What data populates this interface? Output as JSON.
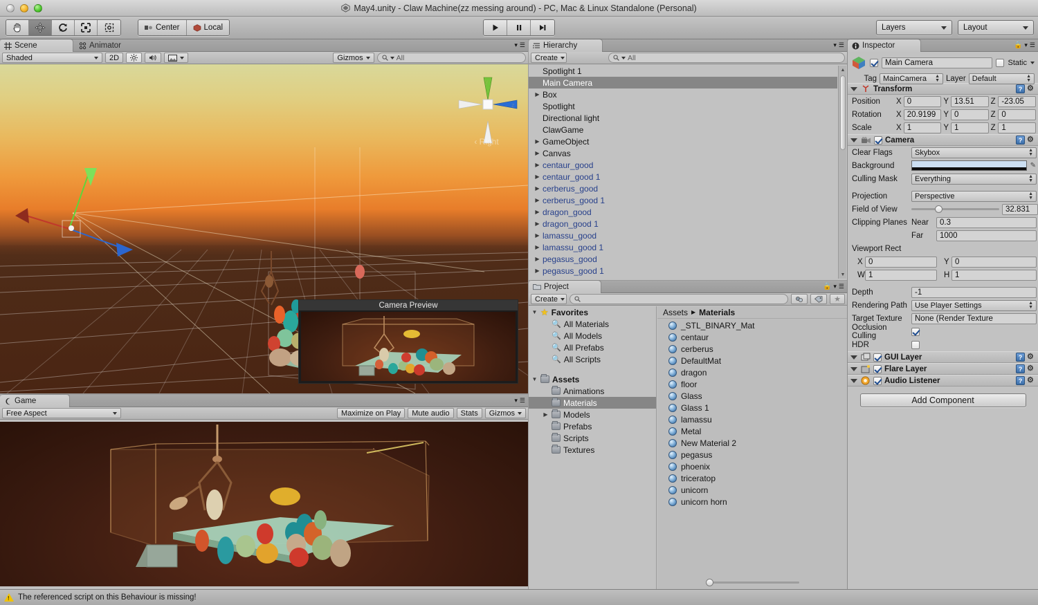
{
  "window": {
    "title": "May4.unity - Claw Machine(zz messing around) - PC, Mac & Linux Standalone (Personal)",
    "traffic_lights": [
      "close",
      "minimize",
      "zoom"
    ]
  },
  "toolbar": {
    "transform_tools": [
      {
        "name": "hand-tool",
        "icon": "hand",
        "selected": false
      },
      {
        "name": "move-tool",
        "icon": "move",
        "selected": true
      },
      {
        "name": "rotate-tool",
        "icon": "rotate",
        "selected": false
      },
      {
        "name": "scale-tool",
        "icon": "scale",
        "selected": false
      },
      {
        "name": "rect-tool",
        "icon": "rect",
        "selected": false
      }
    ],
    "pivot_mode": "Center",
    "pivot_rotation": "Local",
    "play_controls": [
      {
        "name": "play-button",
        "glyph": "▶"
      },
      {
        "name": "pause-button",
        "glyph": "❙❙"
      },
      {
        "name": "step-button",
        "glyph": "▶❙"
      }
    ],
    "layers_label": "Layers",
    "layout_label": "Layout"
  },
  "scene_panel": {
    "tabs": [
      {
        "label": "Scene",
        "icon": "grid-icon",
        "active": true
      },
      {
        "label": "Animator",
        "icon": "animator-icon",
        "active": false
      }
    ],
    "draw_mode": "Shaded",
    "toggle_2d": "2D",
    "lighting_icon": "sun-icon",
    "audio_icon": "speaker-icon",
    "fx_icon": "image-icon",
    "gizmos_label": "Gizmos",
    "search_placeholder": "All",
    "search_value": "",
    "axis_gizmo": {
      "y": "y",
      "z": "z",
      "view_label": "‹ Right"
    },
    "camera_preview_title": "Camera Preview"
  },
  "game_panel": {
    "tab_label": "Game",
    "aspect": "Free Aspect",
    "maximize_on_play": "Maximize on Play",
    "mute_audio": "Mute audio",
    "stats": "Stats",
    "gizmos": "Gizmos"
  },
  "hierarchy": {
    "tab_label": "Hierarchy",
    "create_label": "Create",
    "search_placeholder": "All",
    "search_value": "",
    "items": [
      {
        "label": "Spotlight 1",
        "expandable": false,
        "selected": false,
        "prefab": false
      },
      {
        "label": "Main Camera",
        "expandable": false,
        "selected": true,
        "prefab": false
      },
      {
        "label": "Box",
        "expandable": true,
        "selected": false,
        "prefab": false
      },
      {
        "label": "Spotlight",
        "expandable": false,
        "selected": false,
        "prefab": false
      },
      {
        "label": "Directional light",
        "expandable": false,
        "selected": false,
        "prefab": false
      },
      {
        "label": "ClawGame",
        "expandable": false,
        "selected": false,
        "prefab": false
      },
      {
        "label": "GameObject",
        "expandable": true,
        "selected": false,
        "prefab": false
      },
      {
        "label": "Canvas",
        "expandable": true,
        "selected": false,
        "prefab": false
      },
      {
        "label": "centaur_good",
        "expandable": true,
        "selected": false,
        "prefab": true
      },
      {
        "label": "centaur_good 1",
        "expandable": true,
        "selected": false,
        "prefab": true
      },
      {
        "label": "cerberus_good",
        "expandable": true,
        "selected": false,
        "prefab": true
      },
      {
        "label": "cerberus_good 1",
        "expandable": true,
        "selected": false,
        "prefab": true
      },
      {
        "label": "dragon_good",
        "expandable": true,
        "selected": false,
        "prefab": true
      },
      {
        "label": "dragon_good 1",
        "expandable": true,
        "selected": false,
        "prefab": true
      },
      {
        "label": "lamassu_good",
        "expandable": true,
        "selected": false,
        "prefab": true
      },
      {
        "label": "lamassu_good 1",
        "expandable": true,
        "selected": false,
        "prefab": true
      },
      {
        "label": "pegasus_good",
        "expandable": true,
        "selected": false,
        "prefab": true
      },
      {
        "label": "pegasus_good 1",
        "expandable": true,
        "selected": false,
        "prefab": true
      }
    ]
  },
  "project": {
    "tab_label": "Project",
    "create_label": "Create",
    "search_placeholder": "",
    "search_value": "",
    "breadcrumb": [
      "Assets",
      "Materials"
    ],
    "tree": [
      {
        "label": "Favorites",
        "type": "favorites",
        "depth": 0,
        "expandable": true,
        "selected": false
      },
      {
        "label": "All Materials",
        "type": "search",
        "depth": 1,
        "expandable": false,
        "selected": false
      },
      {
        "label": "All Models",
        "type": "search",
        "depth": 1,
        "expandable": false,
        "selected": false
      },
      {
        "label": "All Prefabs",
        "type": "search",
        "depth": 1,
        "expandable": false,
        "selected": false
      },
      {
        "label": "All Scripts",
        "type": "search",
        "depth": 1,
        "expandable": false,
        "selected": false
      },
      {
        "label": "",
        "type": "spacer",
        "depth": 0,
        "expandable": false,
        "selected": false
      },
      {
        "label": "Assets",
        "type": "folder",
        "depth": 0,
        "expandable": true,
        "selected": false
      },
      {
        "label": "Animations",
        "type": "folder",
        "depth": 1,
        "expandable": false,
        "selected": false
      },
      {
        "label": "Materials",
        "type": "folder",
        "depth": 1,
        "expandable": false,
        "selected": true
      },
      {
        "label": "Models",
        "type": "folder",
        "depth": 1,
        "expandable": true,
        "selected": false
      },
      {
        "label": "Prefabs",
        "type": "folder",
        "depth": 1,
        "expandable": false,
        "selected": false
      },
      {
        "label": "Scripts",
        "type": "folder",
        "depth": 1,
        "expandable": false,
        "selected": false
      },
      {
        "label": "Textures",
        "type": "folder",
        "depth": 1,
        "expandable": false,
        "selected": false
      }
    ],
    "assets": [
      "_STL_BINARY_Mat",
      "centaur",
      "cerberus",
      "DefaultMat",
      "dragon",
      "floor",
      "Glass",
      "Glass 1",
      "lamassu",
      "Metal",
      "New Material 2",
      "pegasus",
      "phoenix",
      "triceratop",
      "unicorn",
      "unicorn horn"
    ]
  },
  "inspector": {
    "tab_label": "Inspector",
    "object_name": "Main Camera",
    "object_enabled": true,
    "static_label": "Static",
    "static_checked": false,
    "tag_label": "Tag",
    "tag_value": "MainCamera",
    "layer_label": "Layer",
    "layer_value": "Default",
    "transform": {
      "title": "Transform",
      "rows": [
        {
          "label": "Position",
          "x": "0",
          "y": "13.51",
          "z": "-23.05"
        },
        {
          "label": "Rotation",
          "x": "20.9199",
          "y": "0",
          "z": "0"
        },
        {
          "label": "Scale",
          "x": "1",
          "y": "1",
          "z": "1"
        }
      ]
    },
    "camera": {
      "title": "Camera",
      "enabled": true,
      "clear_flags_label": "Clear Flags",
      "clear_flags_value": "Skybox",
      "background_label": "Background",
      "background_color": "#ccdff2",
      "culling_mask_label": "Culling Mask",
      "culling_mask_value": "Everything",
      "projection_label": "Projection",
      "projection_value": "Perspective",
      "fov_label": "Field of View",
      "fov_value": "32.831",
      "fov_pct": 27,
      "clipping_label": "Clipping Planes",
      "near_label": "Near",
      "near_value": "0.3",
      "far_label": "Far",
      "far_value": "1000",
      "viewport_label": "Viewport Rect",
      "viewport": {
        "x_label": "X",
        "x": "0",
        "y_label": "Y",
        "y": "0",
        "w_label": "W",
        "w": "1",
        "h_label": "H",
        "h": "1"
      },
      "depth_label": "Depth",
      "depth_value": "-1",
      "rendering_path_label": "Rendering Path",
      "rendering_path_value": "Use Player Settings",
      "target_texture_label": "Target Texture",
      "target_texture_value": "None (Render Texture",
      "occlusion_label": "Occlusion Culling",
      "occlusion_checked": true,
      "hdr_label": "HDR",
      "hdr_checked": false
    },
    "components": [
      {
        "title": "GUI Layer",
        "enabled": true,
        "icon": "gui-layer-icon"
      },
      {
        "title": "Flare Layer",
        "enabled": true,
        "icon": "flare-layer-icon"
      },
      {
        "title": "Audio Listener",
        "enabled": true,
        "icon": "audio-listener-icon"
      }
    ],
    "add_component_label": "Add Component"
  },
  "status_bar": {
    "message": "The referenced script on this Behaviour is missing!",
    "icon": "warning-icon"
  }
}
